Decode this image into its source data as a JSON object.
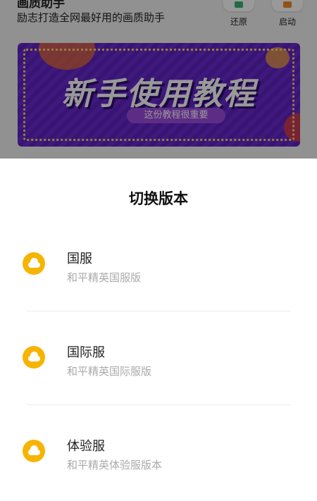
{
  "app": {
    "title_partial": "画质助手",
    "slogan": "励志打造全网最好用的画质助手",
    "tools": [
      {
        "label": "还原",
        "icon": "restore-icon",
        "color": "#3cb371"
      },
      {
        "label": "启动",
        "icon": "rocket-icon",
        "color": "#f08a24"
      }
    ]
  },
  "banner": {
    "title": "新手使用教程",
    "subtitle": "这份教程很重要"
  },
  "sheet": {
    "title": "切换版本",
    "options": [
      {
        "name": "国服",
        "desc": "和平精英国服版",
        "icon": "cloud-icon"
      },
      {
        "name": "国际服",
        "desc": "和平精英国际服版",
        "icon": "cloud-icon"
      },
      {
        "name": "体验服",
        "desc": "和平精英体验服版本",
        "icon": "cloud-icon"
      }
    ]
  },
  "colors": {
    "accent_icon": "#f6b400",
    "banner_purple": "#6a2ad0",
    "overlay": "rgba(0,0,0,0.40)"
  }
}
